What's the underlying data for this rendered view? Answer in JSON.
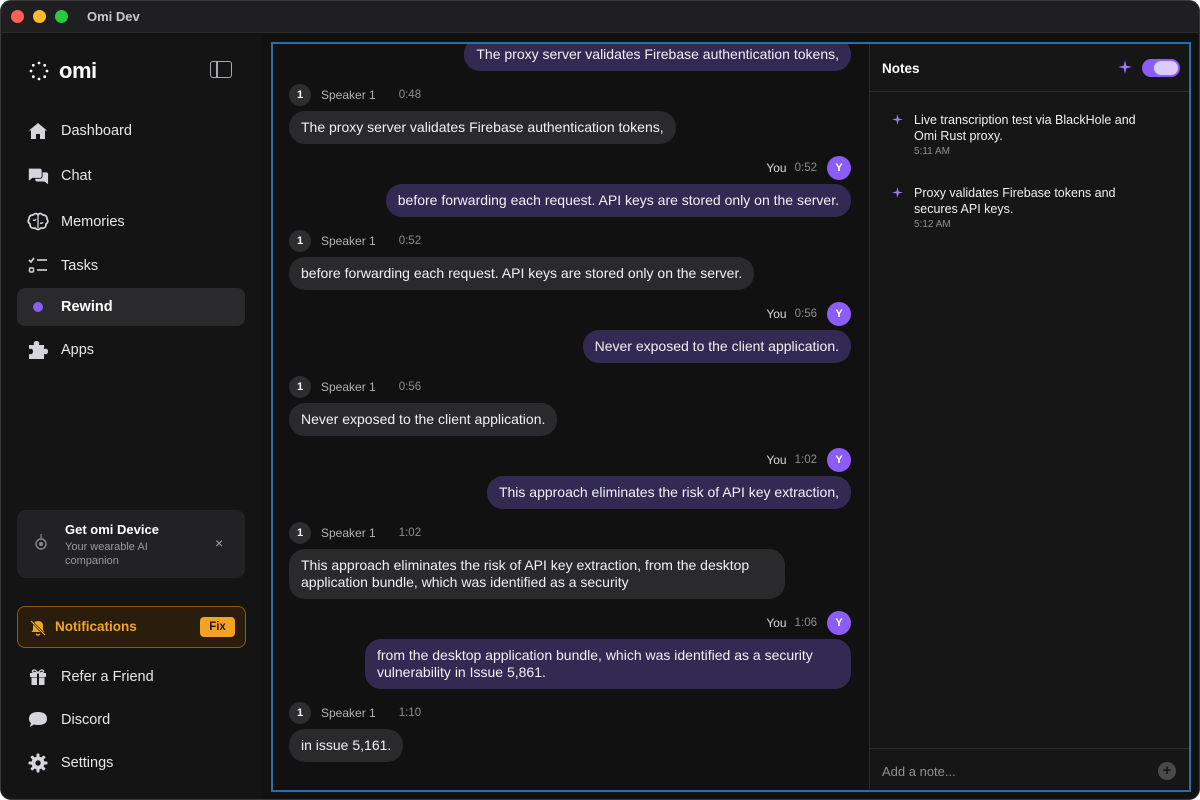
{
  "window": {
    "title": "Omi Dev"
  },
  "sidebar": {
    "logo": "omi",
    "items": [
      {
        "label": "Dashboard",
        "icon": "home-icon",
        "active": false
      },
      {
        "label": "Chat",
        "icon": "chat-icon",
        "active": false
      },
      {
        "label": "Memories",
        "icon": "brain-icon",
        "active": false
      },
      {
        "label": "Tasks",
        "icon": "tasks-icon",
        "active": false
      },
      {
        "label": "Rewind",
        "icon": "dot-icon",
        "active": true
      },
      {
        "label": "Apps",
        "icon": "puzzle-icon",
        "active": false
      }
    ],
    "promo": {
      "title": "Get omi Device",
      "subtitle": "Your wearable AI companion",
      "close": "×"
    },
    "notification": {
      "label": "Notifications",
      "action": "Fix"
    },
    "bottom_items": [
      {
        "label": "Refer a Friend",
        "icon": "gift-icon"
      },
      {
        "label": "Discord",
        "icon": "discord-icon"
      },
      {
        "label": "Settings",
        "icon": "gear-icon"
      }
    ]
  },
  "transcript": {
    "top_clipped": "The proxy server validates Firebase authentication tokens,",
    "messages": [
      {
        "speaker": "Speaker 1",
        "badge": "1",
        "time": "0:48",
        "text": "The proxy server validates Firebase authentication tokens,",
        "mine": false
      },
      {
        "speaker": "You",
        "badge": "Y",
        "time": "0:52",
        "text": "before forwarding each request. API keys are stored only on the server.",
        "mine": true
      },
      {
        "speaker": "Speaker 1",
        "badge": "1",
        "time": "0:52",
        "text": "before forwarding each request. API keys are stored only on the server.",
        "mine": false
      },
      {
        "speaker": "You",
        "badge": "Y",
        "time": "0:56",
        "text": "Never exposed to the client application.",
        "mine": true
      },
      {
        "speaker": "Speaker 1",
        "badge": "1",
        "time": "0:56",
        "text": "Never exposed to the client application.",
        "mine": false
      },
      {
        "speaker": "You",
        "badge": "Y",
        "time": "1:02",
        "text": "This approach eliminates the risk of API key extraction,",
        "mine": true
      },
      {
        "speaker": "Speaker 1",
        "badge": "1",
        "time": "1:02",
        "text": "This approach eliminates the risk of API key extraction, from the desktop application bundle, which was identified as a security",
        "mine": false
      },
      {
        "speaker": "You",
        "badge": "Y",
        "time": "1:06",
        "text": "from the desktop application bundle, which was identified as a security vulnerability in Issue 5,861.",
        "mine": true
      },
      {
        "speaker": "Speaker 1",
        "badge": "1",
        "time": "1:10",
        "text": "in issue 5,161.",
        "mine": false
      }
    ]
  },
  "notes": {
    "title": "Notes",
    "items": [
      {
        "text": "Live transcription test via BlackHole and Omi Rust proxy.",
        "time": "5:11 AM"
      },
      {
        "text": "Proxy validates Firebase tokens and secures API keys.",
        "time": "5:12 AM"
      }
    ],
    "input_placeholder": "Add a note...",
    "add_icon": "+"
  },
  "colors": {
    "accent": "#8b5cf6",
    "focus_border": "#2a6ea8",
    "warning": "#f0a52b"
  }
}
